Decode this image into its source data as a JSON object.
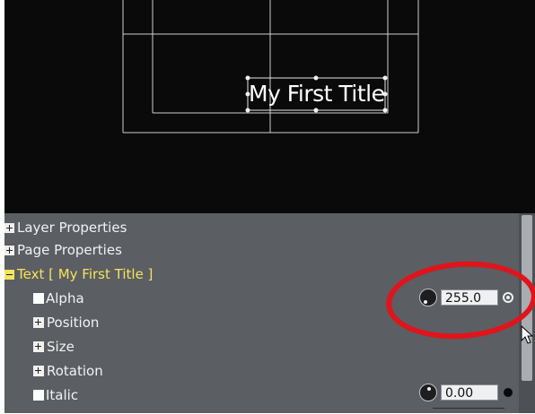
{
  "canvas": {
    "title_text": "My First Title"
  },
  "properties": {
    "groups": [
      {
        "label": "Layer Properties"
      },
      {
        "label": "Page Properties"
      },
      {
        "label": "Text [ My First Title ]"
      }
    ],
    "items": [
      {
        "label": "Alpha",
        "value": "255.0"
      },
      {
        "label": "Position"
      },
      {
        "label": "Size"
      },
      {
        "label": "Rotation"
      },
      {
        "label": "Italic",
        "value": "0.00"
      }
    ]
  },
  "colors": {
    "annotation": "#e0141b",
    "selected_group": "#f4e45a",
    "panel": "#5b5e63"
  },
  "icons": [
    "expand-icon",
    "collapse-icon",
    "knob-icon",
    "keyframe-icon",
    "mouse-cursor-icon"
  ]
}
